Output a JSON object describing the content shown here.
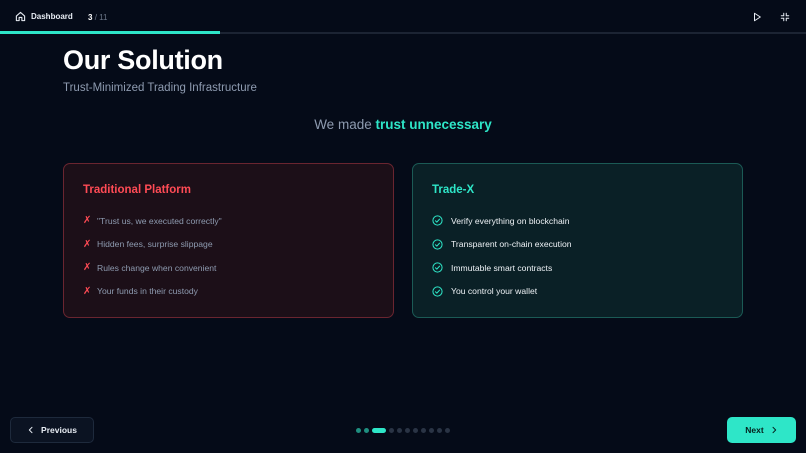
{
  "topbar": {
    "home_label": "Dashboard",
    "slide_current": "3",
    "slide_separator": "/",
    "slide_total": "11",
    "progress_fraction": 0.273,
    "icons": {
      "home": "home-icon",
      "play": "play-icon",
      "fullscreen": "fullscreen-exit-icon"
    }
  },
  "slide": {
    "title": "Our Solution",
    "subtitle": "Trust-Minimized Trading Infrastructure",
    "tagline_prefix": "We made",
    "tagline_highlight": "trust unnecessary"
  },
  "cards": {
    "left": {
      "title": "Traditional Platform",
      "marker": "✗",
      "items": [
        "\"Trust us, we executed correctly\"",
        "Hidden fees, surprise slippage",
        "Rules change when convenient",
        "Your funds in their custody"
      ]
    },
    "right": {
      "title": "Trade-X",
      "items": [
        "Verify everything on blockchain",
        "Transparent on-chain execution",
        "Immutable smart contracts",
        "You control your wallet"
      ]
    }
  },
  "nav": {
    "previous_label": "Previous",
    "next_label": "Next",
    "total_slides": 11,
    "current_index": 2
  },
  "colors": {
    "accent": "#2ee6c8",
    "danger": "#ff4b55",
    "background": "#050b18"
  }
}
